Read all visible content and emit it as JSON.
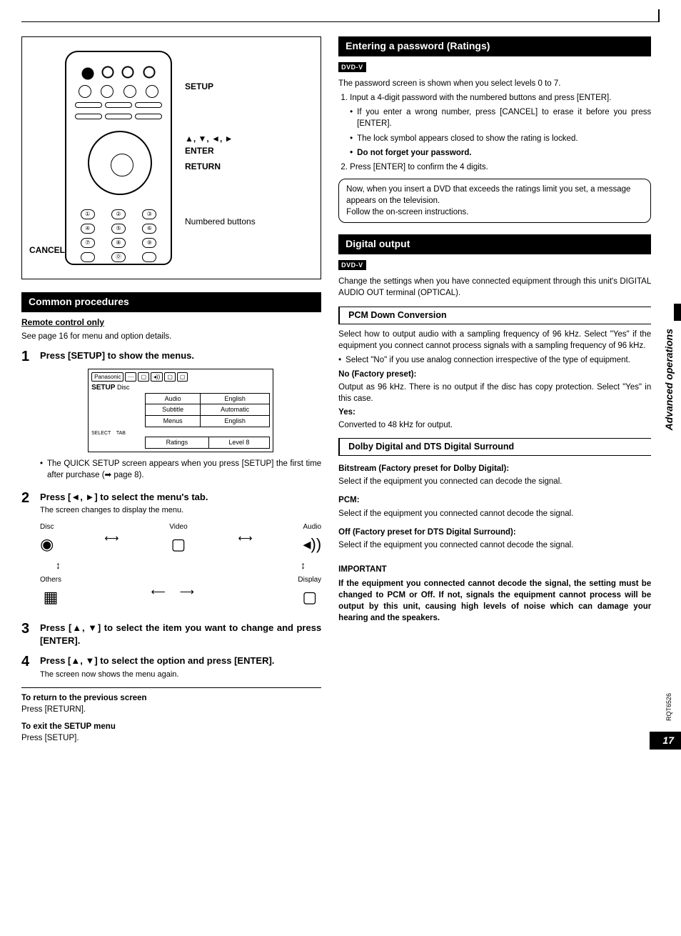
{
  "sidebar": {
    "section": "Advanced operations",
    "doc_code": "RQT6526"
  },
  "page_number": "17",
  "remote": {
    "callouts": {
      "setup": "SETUP",
      "arrows": "▲, ▼, ◄, ►",
      "enter": "ENTER",
      "return": "RETURN",
      "numbered": "Numbered buttons",
      "cancel": "CANCEL"
    }
  },
  "left": {
    "heading_common": "Common procedures",
    "remote_only": "Remote control only",
    "see_page": "See page 16 for menu and option details.",
    "steps": {
      "s1": {
        "title": "Press [SETUP] to show the menus.",
        "note": "The QUICK SETUP screen appears when you press [SETUP] the first time after purchase (➡ page 8)."
      },
      "s2": {
        "title": "Press [◄, ►] to select the menu's tab.",
        "sub": "The screen changes to display the menu."
      },
      "s3": {
        "title": "Press [▲, ▼] to select the item you want to change and press [ENTER]."
      },
      "s4": {
        "title": "Press [▲, ▼] to select the option and press [ENTER].",
        "sub": "The screen now shows the menu again."
      }
    },
    "screen": {
      "brand": "Panasonic",
      "setup": "SETUP",
      "tab": "Disc",
      "rows": [
        [
          "Audio",
          "English"
        ],
        [
          "Subtitle",
          "Automatic"
        ],
        [
          "Menus",
          "English"
        ],
        [
          "Ratings",
          "Level 8"
        ]
      ],
      "select": "SELECT",
      "tab_lbl": "TAB"
    },
    "tabs": {
      "disc": "Disc",
      "video": "Video",
      "audio": "Audio",
      "display": "Display",
      "others": "Others"
    },
    "footer": {
      "return_h": "To return to the previous screen",
      "return_b": "Press [RETURN].",
      "exit_h": "To exit the SETUP menu",
      "exit_b": "Press [SETUP]."
    }
  },
  "right": {
    "heading_pw": "Entering a password (Ratings)",
    "dvd_badge": "DVD-V",
    "pw_intro": "The password screen is shown when you select levels 0 to 7.",
    "pw_step1": "Input a 4-digit password with the numbered buttons and press [ENTER].",
    "pw_b1": "If you enter a wrong number, press [CANCEL] to erase it before you press [ENTER].",
    "pw_b2": "The lock symbol appears closed to show the rating is locked.",
    "pw_b3": "Do not forget your password.",
    "pw_step2": "Press [ENTER] to confirm the 4 digits.",
    "pw_box": "Now, when you insert a DVD that exceeds the ratings limit you set, a message appears on the television.\nFollow the on-screen instructions.",
    "heading_do": "Digital output",
    "do_intro": "Change the settings when you have connected equipment through this unit's DIGITAL AUDIO OUT terminal (OPTICAL).",
    "pcm_h": "PCM Down Conversion",
    "pcm_p1": "Select how to output audio with a sampling frequency of 96 kHz. Select \"Yes\" if the equipment you connect cannot process signals with a sampling frequency of 96 kHz.",
    "pcm_p2": "Select \"No\" if you use analog connection irrespective of the type of equipment.",
    "pcm_no_h": "No (Factory preset):",
    "pcm_no_b": "Output as 96 kHz. There is no output if the disc has copy protection. Select \"Yes\" in this case.",
    "pcm_yes_h": "Yes:",
    "pcm_yes_b": "Converted to 48 kHz for output.",
    "dd_h": "Dolby Digital and DTS Digital Surround",
    "dd_bit_h": "Bitstream (Factory preset for Dolby Digital):",
    "dd_bit_b": "Select if the equipment you connected can decode the signal.",
    "dd_pcm_h": "PCM:",
    "dd_pcm_b": "Select if the equipment you connected cannot decode the signal.",
    "dd_off_h": "Off (Factory preset for DTS Digital Surround):",
    "dd_off_b": "Select if the equipment you connected cannot decode the signal.",
    "important_h": "IMPORTANT",
    "important_b": "If the equipment you connected cannot decode the signal, the setting must be changed to PCM or Off. If not, signals the equipment cannot process will be output by this unit, causing high levels of noise which can damage your hearing and the speakers."
  }
}
